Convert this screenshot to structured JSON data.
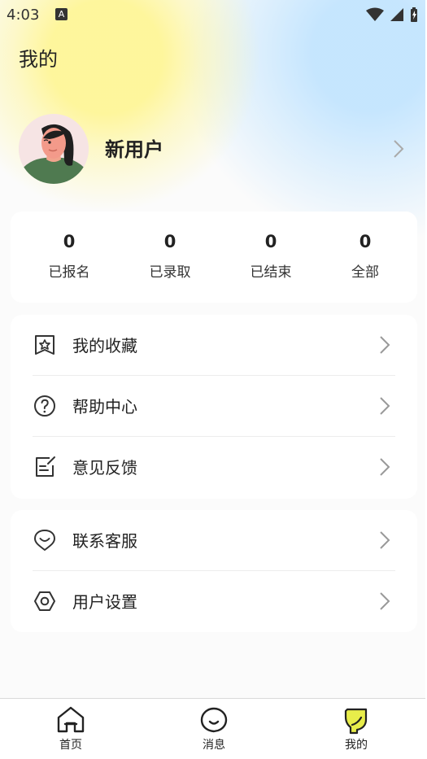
{
  "status": {
    "time": "4:03",
    "notification_icon": "A"
  },
  "page": {
    "title": "我的"
  },
  "profile": {
    "name": "新用户"
  },
  "stats": [
    {
      "value": "0",
      "label": "已报名"
    },
    {
      "value": "0",
      "label": "已录取"
    },
    {
      "value": "0",
      "label": "已结束"
    },
    {
      "value": "0",
      "label": "全部"
    }
  ],
  "menu_group_1": [
    {
      "label": "我的收藏",
      "icon": "star-bookmark-icon"
    },
    {
      "label": "帮助中心",
      "icon": "question-icon"
    },
    {
      "label": "意见反馈",
      "icon": "edit-note-icon"
    }
  ],
  "menu_group_2": [
    {
      "label": "联系客服",
      "icon": "smile-chat-icon"
    },
    {
      "label": "用户设置",
      "icon": "settings-hex-icon"
    }
  ],
  "tabs": [
    {
      "label": "首页",
      "icon": "home-icon"
    },
    {
      "label": "消息",
      "icon": "message-smile-icon"
    },
    {
      "label": "我的",
      "icon": "profile-icon",
      "active": true
    }
  ],
  "colors": {
    "accent_yellow": "#e8ed4a",
    "avatar_green": "#4f7a50",
    "text": "#222222"
  }
}
